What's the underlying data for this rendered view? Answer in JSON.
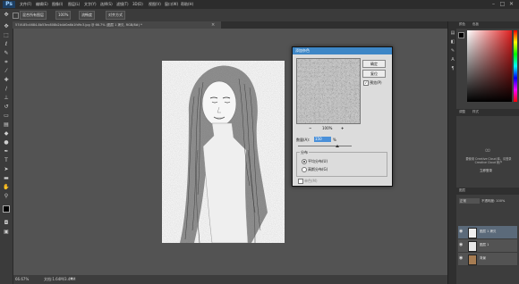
{
  "app": {
    "logo": "Ps",
    "menu": [
      "文件(F)",
      "编辑(E)",
      "图像(I)",
      "图层(L)",
      "文字(Y)",
      "选择(S)",
      "滤镜(T)",
      "3D(D)",
      "视图(V)",
      "窗口(W)",
      "帮助(H)"
    ],
    "window_controls": [
      "–",
      "□",
      "✕"
    ]
  },
  "options_bar": {
    "items": [
      "混合所有图层",
      "100%",
      "流畅度",
      "对齐方式"
    ]
  },
  "document": {
    "tab_title": "574f-85c4684-8b53ec808b2b4d0a6b1fd9c3.jpg @ 66.7% (图层 1 拷贝, RGB/8#) *",
    "close": "×"
  },
  "status": {
    "zoom": "66.67%",
    "doc_info": "文档:1.64M/3.49M"
  },
  "dialog": {
    "title": "添加杂色",
    "ok_label": "确定",
    "cancel_label": "复位",
    "preview_label": "预览(P)",
    "preview_checked": true,
    "zoom_out": "−",
    "zoom_level": "100%",
    "zoom_in": "+",
    "amount_label": "数量(A):",
    "amount_value": "150",
    "amount_unit": "%",
    "distribution_label": "分布",
    "uniform_label": "平均分布(U)",
    "gaussian_label": "高斯分布(G)",
    "mono_label": "单色(M)"
  },
  "right_panel": {
    "tabs_top": [
      "颜色",
      "色板"
    ],
    "tabs_mid": [
      "调整",
      "样式"
    ],
    "libraries_text": "要使用 Creative Cloud 库，请登录 Creative Cloud 帐户",
    "libraries_button": "立即登录",
    "layers_tab": "图层",
    "layers_kind": "正常",
    "layers_opacity": "不透明度: 100%",
    "layers": [
      {
        "name": "图层 1 拷贝",
        "selected": true,
        "thumb": "#f0f0f0"
      },
      {
        "name": "图层 1",
        "selected": false,
        "thumb": "#e6e6e6"
      },
      {
        "name": "背景",
        "selected": false,
        "thumb": "#a67c52"
      }
    ]
  },
  "colors": {
    "accent_blue": "#3d86c6",
    "picker_red": "#e02020",
    "panel_bg": "#3d3d3d"
  }
}
